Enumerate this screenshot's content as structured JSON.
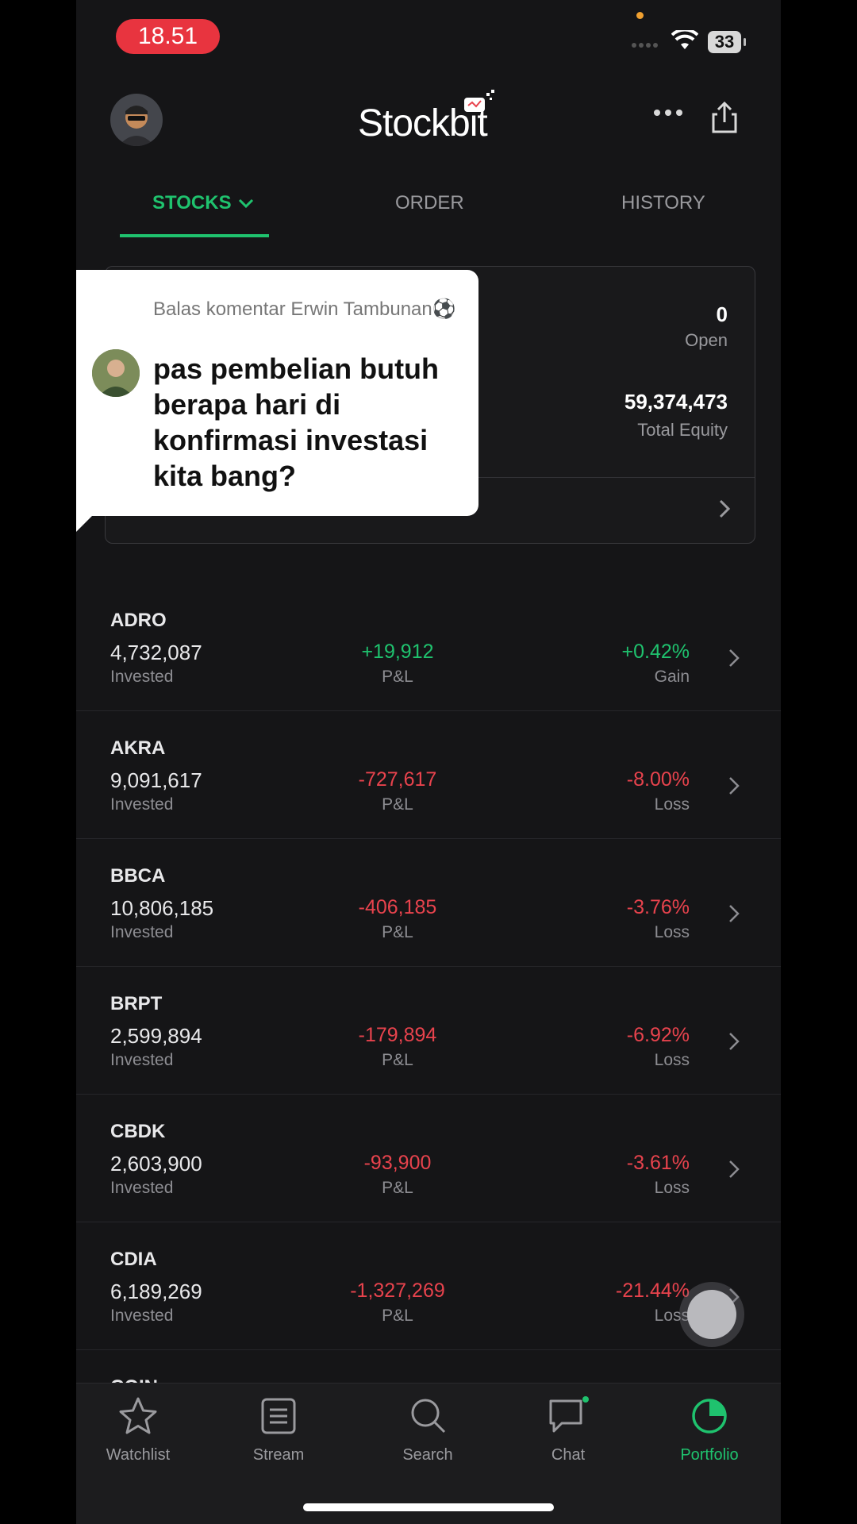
{
  "status_bar": {
    "time": "18.51",
    "battery": "33"
  },
  "header": {
    "app_name": "Stockbit"
  },
  "tabs": [
    {
      "label": "STOCKS",
      "active": true
    },
    {
      "label": "ORDER",
      "active": false
    },
    {
      "label": "HISTORY",
      "active": false
    }
  ],
  "summary": {
    "open_count": "0",
    "open_label": "Open",
    "total_equity": "59,374,473",
    "total_equity_label": "Total Equity"
  },
  "comment": {
    "reply_header": "Balas komentar Erwin Tambunan⚽",
    "text": "pas pembelian butuh berapa hari di konfirmasi investasi kita bang?"
  },
  "labels": {
    "invested": "Invested",
    "pnl": "P&L",
    "gain": "Gain",
    "loss": "Loss"
  },
  "holdings": [
    {
      "ticker": "ADRO",
      "invested": "4,732,087",
      "pnl": "+19,912",
      "pct": "+0.42%",
      "status": "Gain"
    },
    {
      "ticker": "AKRA",
      "invested": "9,091,617",
      "pnl": "-727,617",
      "pct": "-8.00%",
      "status": "Loss"
    },
    {
      "ticker": "BBCA",
      "invested": "10,806,185",
      "pnl": "-406,185",
      "pct": "-3.76%",
      "status": "Loss"
    },
    {
      "ticker": "BRPT",
      "invested": "2,599,894",
      "pnl": "-179,894",
      "pct": "-6.92%",
      "status": "Loss"
    },
    {
      "ticker": "CBDK",
      "invested": "2,603,900",
      "pnl": "-93,900",
      "pct": "-3.61%",
      "status": "Loss"
    },
    {
      "ticker": "CDIA",
      "invested": "6,189,269",
      "pnl": "-1,327,269",
      "pct": "-21.44%",
      "status": "Loss"
    }
  ],
  "partial_row": {
    "ticker": "COIN"
  },
  "bottom_nav": [
    {
      "label": "Watchlist",
      "icon": "star-icon"
    },
    {
      "label": "Stream",
      "icon": "stream-icon"
    },
    {
      "label": "Search",
      "icon": "search-icon"
    },
    {
      "label": "Chat",
      "icon": "chat-icon"
    },
    {
      "label": "Portfolio",
      "icon": "portfolio-icon",
      "active": true
    }
  ],
  "colors": {
    "accent": "#1fc26e",
    "loss": "#e8434d",
    "background": "#151517"
  }
}
